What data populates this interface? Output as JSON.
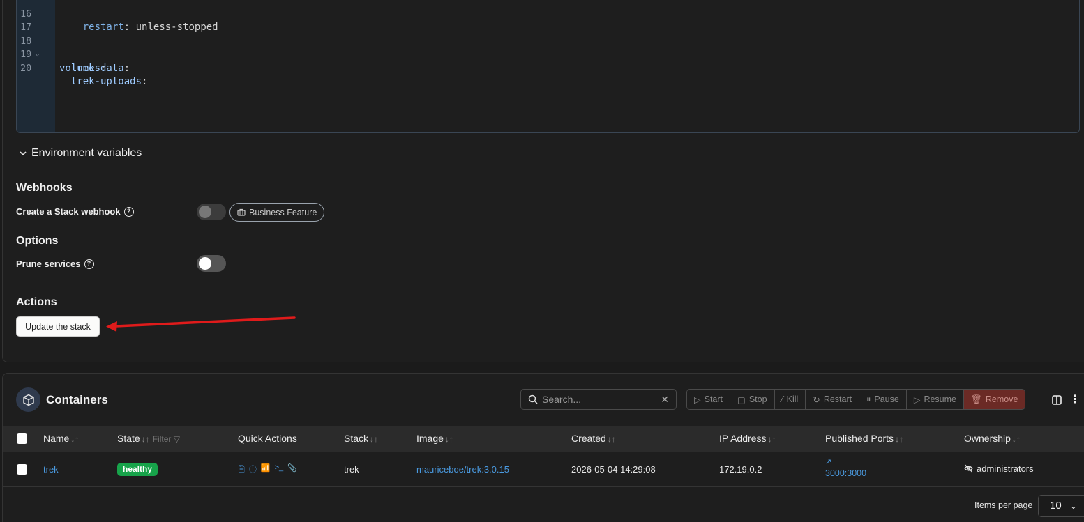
{
  "editor": {
    "lines": [
      {
        "num": "16",
        "indent": "    ",
        "key": "restart",
        "value": " unless-stopped"
      },
      {
        "num": "17",
        "indent": "",
        "key": "",
        "value": ""
      },
      {
        "num": "18",
        "indent": "",
        "key": "volumes",
        "value": "",
        "fold": "⌄"
      },
      {
        "num": "19",
        "indent": "  ",
        "key": "trek-data",
        "value": ""
      },
      {
        "num": "20",
        "indent": "  ",
        "key": "trek-uploads",
        "value": ""
      }
    ]
  },
  "env": {
    "label": "Environment variables"
  },
  "webhooks": {
    "title": "Webhooks",
    "create_label": "Create a Stack webhook",
    "business_badge": "Business Feature"
  },
  "options": {
    "title": "Options",
    "prune_label": "Prune services"
  },
  "actions": {
    "title": "Actions",
    "update_button": "Update the stack"
  },
  "containers": {
    "title": "Containers",
    "search_placeholder": "Search...",
    "toolbar": [
      "Start",
      "Stop",
      "Kill",
      "Restart",
      "Pause",
      "Resume",
      "Remove"
    ],
    "columns": {
      "name": "Name",
      "state": "State",
      "state_filter": "Filter",
      "quick_actions": "Quick Actions",
      "stack": "Stack",
      "image": "Image",
      "created": "Created",
      "ip": "IP Address",
      "ports": "Published Ports",
      "ownership": "Ownership"
    },
    "rows": [
      {
        "name": "trek",
        "state": "healthy",
        "stack": "trek",
        "image": "mauriceboe/trek:3.0.15",
        "created": "2026-05-04 14:29:08",
        "ip": "172.19.0.2",
        "ports": "3000:3000",
        "ownership": "administrators"
      }
    ],
    "items_per_page_label": "Items per page",
    "items_per_page_value": "10"
  },
  "colors": {
    "accent_link": "#4a9ae0",
    "healthy": "#17a34a",
    "remove": "#6b2a25",
    "annotation_arrow": "#e01b1b"
  }
}
